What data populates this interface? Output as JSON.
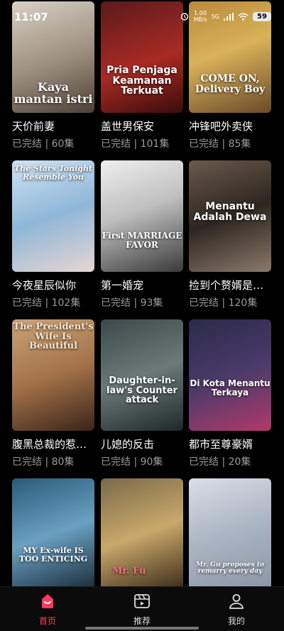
{
  "status_bar": {
    "time": "11:07",
    "net_speed": "1.00",
    "net_unit": "MB/s",
    "signal": "5G",
    "battery": "59"
  },
  "colors": {
    "accent": "#ff3b5c",
    "meta_text": "#9a9a9a"
  },
  "dramas": [
    {
      "title": "天价前妻",
      "meta": "已完结 | 60集",
      "poster_text": "Kaya mantan istri",
      "poster_bg": "linear-gradient(160deg,#d8d1c5,#9a8d7d 55%,#4d4136)"
    },
    {
      "title": "盖世男保安",
      "meta": "已完结 | 101集",
      "poster_text": "Pria Penjaga Keamanan Terkuat",
      "poster_bg": "linear-gradient(160deg,#5a1a1a,#a92a24 55%,#3a0c0c)"
    },
    {
      "title": "冲锋吧外卖侠",
      "meta": "已完结 | 85集",
      "poster_text": "COME ON, Delivery Boy",
      "poster_bg": "linear-gradient(160deg,#b98a3a,#d9b25a 45%,#6a4a2a)"
    },
    {
      "title": "今夜星辰似你",
      "meta": "已完结 | 102集",
      "poster_text": "The Stars Tonight Resemble You",
      "poster_bg": "linear-gradient(160deg,#cfe3f3,#8fb7d8 50%,#e8d6d2)"
    },
    {
      "title": "第一婚宠",
      "meta": "已完结 | 93集",
      "poster_text": "First MARRIAGE FAVOR",
      "poster_bg": "linear-gradient(160deg,#efefef,#bfbfbf 45%,#3a3a3a)"
    },
    {
      "title": "捡到个赘婿是…",
      "meta": "已完结 | 120集",
      "poster_text": "Menantu Adalah Dewa",
      "poster_bg": "linear-gradient(160deg,#6a5a4a,#2d2620 50%,#8a7a6a)"
    },
    {
      "title": "腹黑总裁的惹…",
      "meta": "已完结 | 80集",
      "poster_text": "The President's Wife Is Beautiful",
      "poster_bg": "linear-gradient(160deg,#c9a47a,#a3724a 50%,#3a2418)"
    },
    {
      "title": "儿媳的反击",
      "meta": "已完结 | 90集",
      "poster_text": "Daughter-in-law's Counter attack",
      "poster_bg": "linear-gradient(160deg,#3a4a4a,#6a7a78 50%,#1e2828)"
    },
    {
      "title": "都市至尊豪婿",
      "meta": "已完结 | 20集",
      "poster_text": "Di Kota Menantu Terkaya",
      "poster_bg": "linear-gradient(160deg,#2b2a4a,#4a3a6a 50%,#b03a6a)"
    },
    {
      "title": "",
      "meta": "",
      "poster_text": "MY Ex-wife IS TOO ENTICING",
      "poster_bg": "linear-gradient(160deg,#2a5a7a,#6aa0c0 50%,#1a2a3a)"
    },
    {
      "title": "",
      "meta": "",
      "poster_text": "Mr. Fu",
      "poster_bg": "linear-gradient(160deg,#7a6a4a,#c9a86a 50%,#3a2a1a)"
    },
    {
      "title": "",
      "meta": "",
      "poster_text": "Mr. Gu proposes to remarry every day",
      "poster_bg": "linear-gradient(160deg,#d9dfe6,#aab4c2 50%,#8a96a6)"
    }
  ],
  "bottom_nav": [
    {
      "label": "首页",
      "icon": "home-icon",
      "active": true
    },
    {
      "label": "推荐",
      "icon": "clapperboard-icon",
      "active": false
    },
    {
      "label": "我的",
      "icon": "user-icon",
      "active": false
    }
  ]
}
